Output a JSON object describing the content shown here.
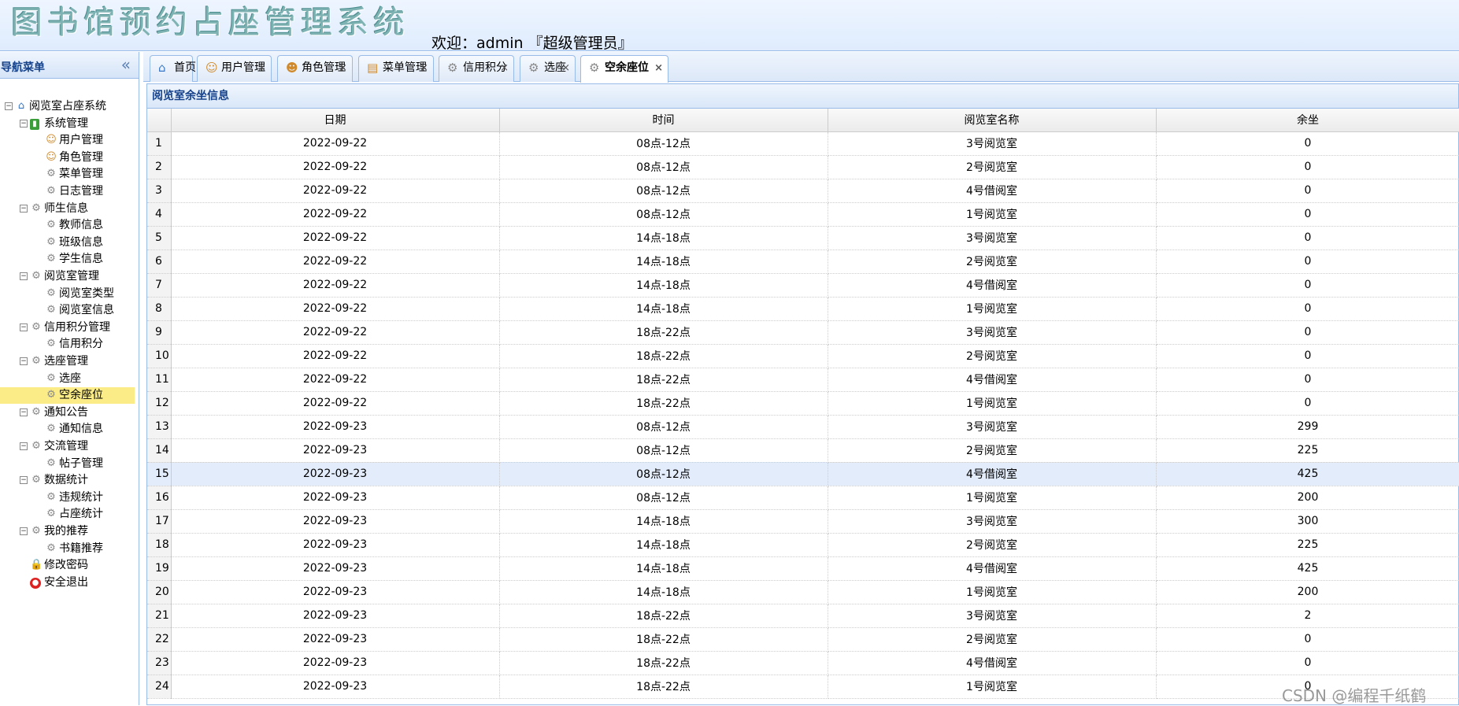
{
  "header": {
    "app_title": "图书馆预约占座管理系统",
    "welcome": "欢迎：admin 『超级管理员』"
  },
  "sidebar": {
    "title": "导航菜单",
    "collapse_glyph": "«",
    "tree": {
      "root": "阅览室占座系统",
      "groups": [
        {
          "label": "系统管理",
          "icon": "green-book-icon",
          "items": [
            "用户管理",
            "角色管理",
            "菜单管理",
            "日志管理"
          ]
        },
        {
          "label": "师生信息",
          "icon": "gear-icon",
          "items": [
            "教师信息",
            "班级信息",
            "学生信息"
          ]
        },
        {
          "label": "阅览室管理",
          "icon": "gear-icon",
          "items": [
            "阅览室类型",
            "阅览室信息"
          ]
        },
        {
          "label": "信用积分管理",
          "icon": "gear-icon",
          "items": [
            "信用积分"
          ]
        },
        {
          "label": "选座管理",
          "icon": "gear-icon",
          "items": [
            "选座",
            "空余座位"
          ]
        },
        {
          "label": "通知公告",
          "icon": "gear-icon",
          "items": [
            "通知信息"
          ]
        },
        {
          "label": "交流管理",
          "icon": "gear-icon",
          "items": [
            "帖子管理"
          ]
        },
        {
          "label": "数据统计",
          "icon": "gear-icon",
          "items": [
            "违规统计",
            "占座统计"
          ]
        },
        {
          "label": "我的推荐",
          "icon": "gear-icon",
          "items": [
            "书籍推荐"
          ]
        }
      ],
      "leaves": [
        "修改密码",
        "安全退出"
      ],
      "selected": "空余座位"
    }
  },
  "tabs": [
    {
      "label": "首页",
      "icon": "home-icon",
      "closable": false
    },
    {
      "label": "用户管理",
      "icon": "user-icon",
      "closable": true
    },
    {
      "label": "角色管理",
      "icon": "role-icon",
      "closable": true
    },
    {
      "label": "菜单管理",
      "icon": "menu-icon",
      "closable": true
    },
    {
      "label": "信用积分",
      "icon": "gear-icon",
      "closable": true
    },
    {
      "label": "选座",
      "icon": "gear-icon",
      "closable": true
    },
    {
      "label": "空余座位",
      "icon": "gear-icon",
      "closable": true,
      "active": true
    }
  ],
  "panel": {
    "title": "阅览室余坐信息",
    "columns": [
      "日期",
      "时间",
      "阅览室名称",
      "余坐"
    ],
    "rows": [
      [
        "1",
        "2022-09-22",
        "08点-12点",
        "3号阅览室",
        "0"
      ],
      [
        "2",
        "2022-09-22",
        "08点-12点",
        "2号阅览室",
        "0"
      ],
      [
        "3",
        "2022-09-22",
        "08点-12点",
        "4号借阅室",
        "0"
      ],
      [
        "4",
        "2022-09-22",
        "08点-12点",
        "1号阅览室",
        "0"
      ],
      [
        "5",
        "2022-09-22",
        "14点-18点",
        "3号阅览室",
        "0"
      ],
      [
        "6",
        "2022-09-22",
        "14点-18点",
        "2号阅览室",
        "0"
      ],
      [
        "7",
        "2022-09-22",
        "14点-18点",
        "4号借阅室",
        "0"
      ],
      [
        "8",
        "2022-09-22",
        "14点-18点",
        "1号阅览室",
        "0"
      ],
      [
        "9",
        "2022-09-22",
        "18点-22点",
        "3号阅览室",
        "0"
      ],
      [
        "10",
        "2022-09-22",
        "18点-22点",
        "2号阅览室",
        "0"
      ],
      [
        "11",
        "2022-09-22",
        "18点-22点",
        "4号借阅室",
        "0"
      ],
      [
        "12",
        "2022-09-22",
        "18点-22点",
        "1号阅览室",
        "0"
      ],
      [
        "13",
        "2022-09-23",
        "08点-12点",
        "3号阅览室",
        "299"
      ],
      [
        "14",
        "2022-09-23",
        "08点-12点",
        "2号阅览室",
        "225"
      ],
      [
        "15",
        "2022-09-23",
        "08点-12点",
        "4号借阅室",
        "425"
      ],
      [
        "16",
        "2022-09-23",
        "08点-12点",
        "1号阅览室",
        "200"
      ],
      [
        "17",
        "2022-09-23",
        "14点-18点",
        "3号阅览室",
        "300"
      ],
      [
        "18",
        "2022-09-23",
        "14点-18点",
        "2号阅览室",
        "225"
      ],
      [
        "19",
        "2022-09-23",
        "14点-18点",
        "4号借阅室",
        "425"
      ],
      [
        "20",
        "2022-09-23",
        "14点-18点",
        "1号阅览室",
        "200"
      ],
      [
        "21",
        "2022-09-23",
        "18点-22点",
        "3号阅览室",
        "2"
      ],
      [
        "22",
        "2022-09-23",
        "18点-22点",
        "2号阅览室",
        "0"
      ],
      [
        "23",
        "2022-09-23",
        "18点-22点",
        "4号借阅室",
        "0"
      ],
      [
        "24",
        "2022-09-23",
        "18点-22点",
        "1号阅览室",
        "0"
      ]
    ],
    "hover_row": "15"
  },
  "watermark": "CSDN @编程千纸鹤",
  "colors": {
    "border": "#99bbe8",
    "selected_bg": "#fbec88",
    "hover_bg": "#e2ecfb",
    "title": "#15428b"
  }
}
